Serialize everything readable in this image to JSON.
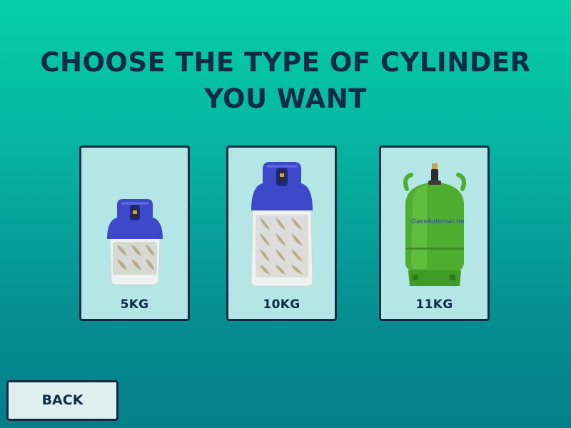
{
  "page": {
    "title_line1": "CHOOSE THE TYPE OF CYLINDER",
    "title_line2": "YOU WANT"
  },
  "options": [
    {
      "label": "5KG"
    },
    {
      "label": "10KG"
    },
    {
      "label": "11KG",
      "image_text": "GassAutomat.no"
    }
  ],
  "back_button": {
    "label": "BACK"
  },
  "colors": {
    "background_top": "#06cfa9",
    "background_bottom": "#067e8a",
    "text_dark": "#0e2c45",
    "card_bg": "#b3e6e4",
    "cylinder_blue": "#3d49c9",
    "cylinder_green": "#4fae2f"
  }
}
